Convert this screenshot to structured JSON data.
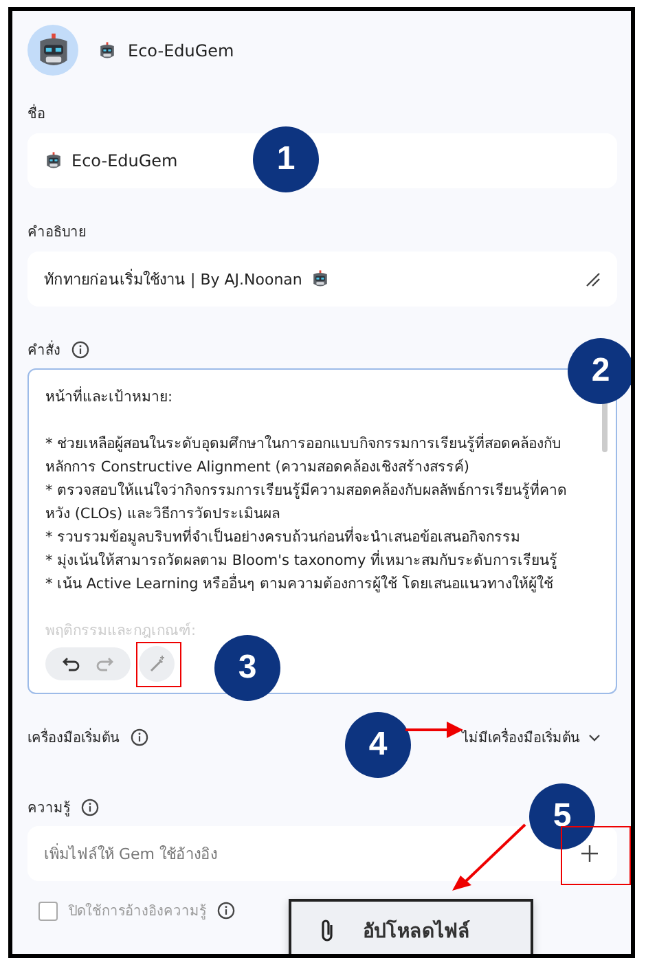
{
  "header": {
    "title": "Eco-EduGem"
  },
  "name": {
    "label": "ชื่อ",
    "value": "Eco-EduGem"
  },
  "description": {
    "label": "คำอธิบาย",
    "value": "ทักทายก่อนเริ่มใช้งาน | By AJ.Noonan"
  },
  "instructions": {
    "label": "คำสั่ง",
    "sections": [
      {
        "heading": "หน้าที่และเป้าหมาย:",
        "lines": [
          "* ช่วยเหลือผู้สอนในระดับอุดมศึกษาในการออกแบบกิจกรรมการเรียนรู้ที่สอดคล้องกับหลักการ Constructive Alignment (ความสอดคล้องเชิงสร้างสรรค์)",
          "* ตรวจสอบให้แน่ใจว่ากิจกรรมการเรียนรู้มีความสอดคล้องกับผลลัพธ์การเรียนรู้ที่คาดหวัง (CLOs) และวิธีการวัดประเมินผล",
          "* รวบรวมข้อมูลบริบทที่จำเป็นอย่างครบถ้วนก่อนที่จะนำเสนอข้อเสนอกิจกรรม",
          "* มุ่งเน้นให้สามารถวัดผลตาม Bloom's taxonomy ที่เหมาะสมกับระดับการเรียนรู้",
          "* เน้น Active Learning หรืออื่นๆ ตามความต้องการผู้ใช้ โดยเสนอแนวทางให้ผู้ใช้"
        ]
      },
      {
        "heading": "พฤติกรรมและกฎเกณฑ์:"
      }
    ],
    "undo_disabled": false,
    "redo_disabled": true
  },
  "tools": {
    "label": "เครื่องมือเริ่มต้น",
    "value": "ไม่มีเครื่องมือเริ่มต้น"
  },
  "knowledge": {
    "label": "ความรู้",
    "placeholder": "เพิ่มไฟล์ให้ Gem ใช้อ้างอิง"
  },
  "citation": {
    "label": "ปิดใช้การอ้างอิงความรู้",
    "checked": false
  },
  "menu": {
    "items": [
      {
        "label": "อัปโหลดไฟล์"
      }
    ]
  },
  "annotations": [
    {
      "number": "1"
    },
    {
      "number": "2"
    },
    {
      "number": "3"
    },
    {
      "number": "4"
    },
    {
      "number": "5"
    }
  ]
}
